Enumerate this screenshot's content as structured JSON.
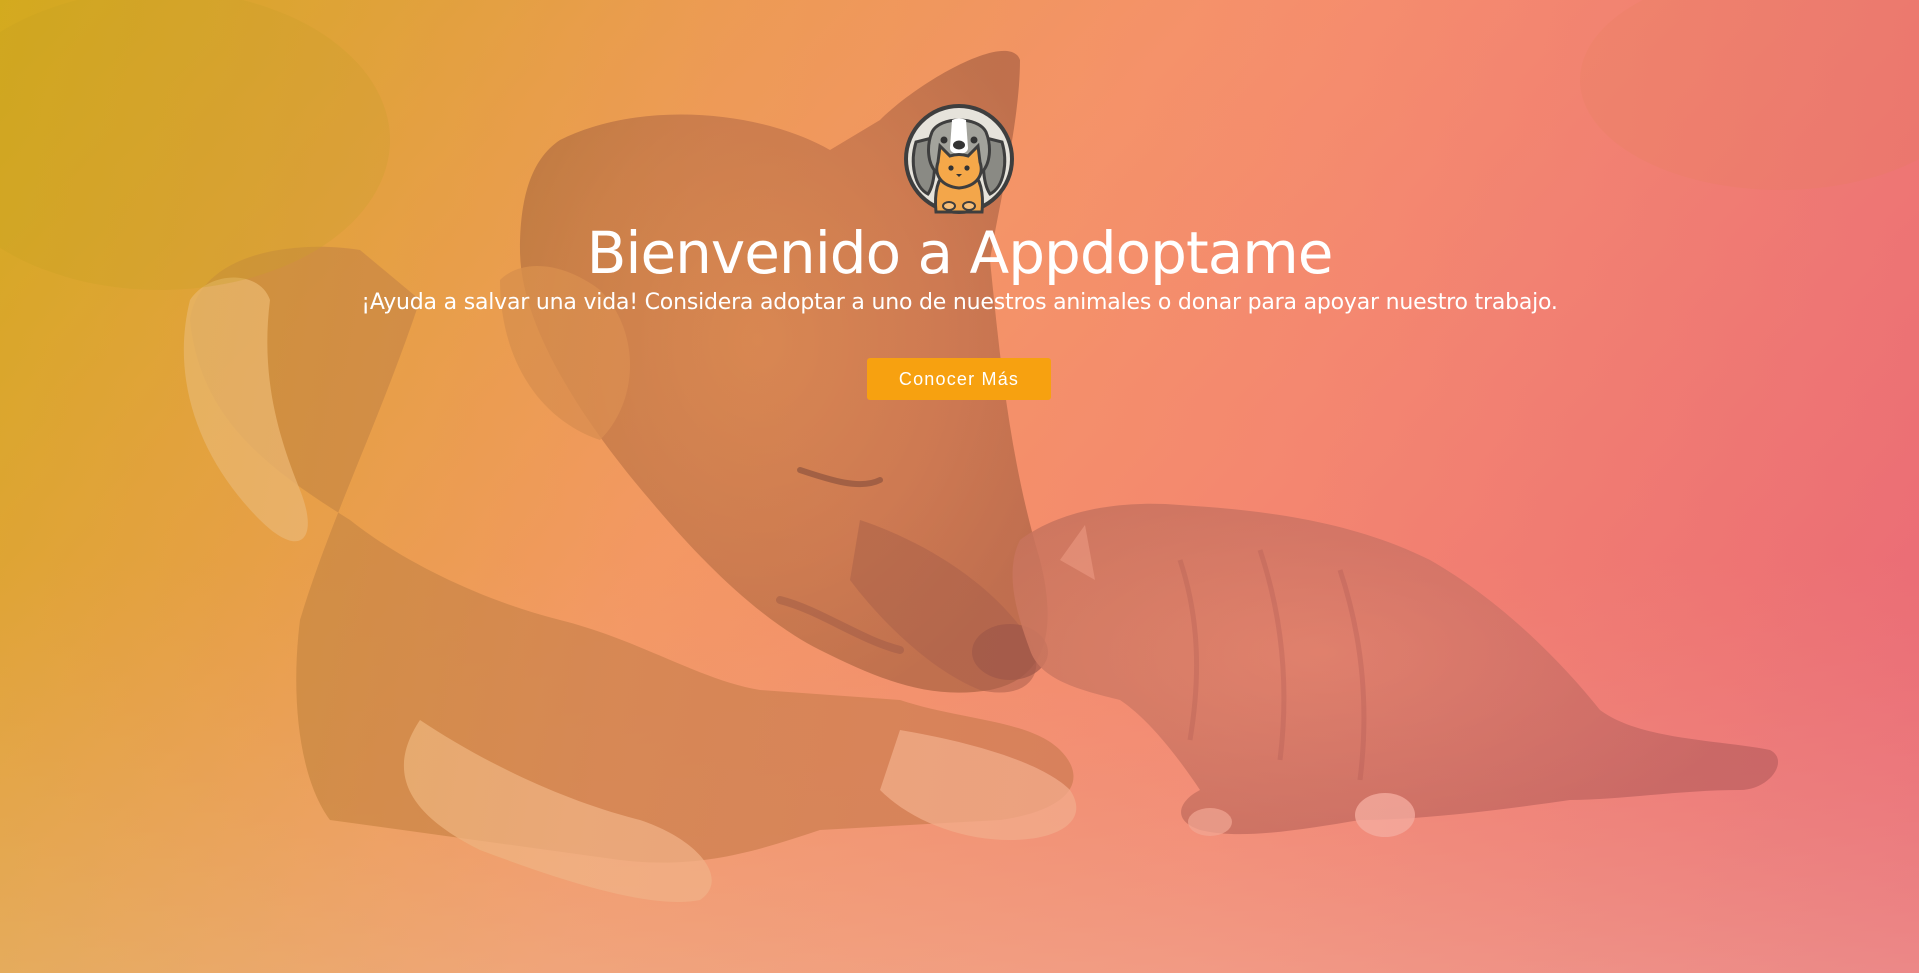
{
  "hero": {
    "title": "Bienvenido a Appdoptame",
    "subtitle": "¡Ayuda a salvar una vida! Considera adoptar a uno de nuestros animales o donar para apoyar nuestro trabajo.",
    "cta_label": "Conocer Más",
    "background_image": "dog-and-kitten-photo",
    "logo_icon": "dog-and-cat-logo-icon"
  },
  "colors": {
    "cta_background": "#f7a110",
    "overlay_start": "#d6aa1e",
    "overlay_end": "#e8647a",
    "text": "#ffffff"
  }
}
